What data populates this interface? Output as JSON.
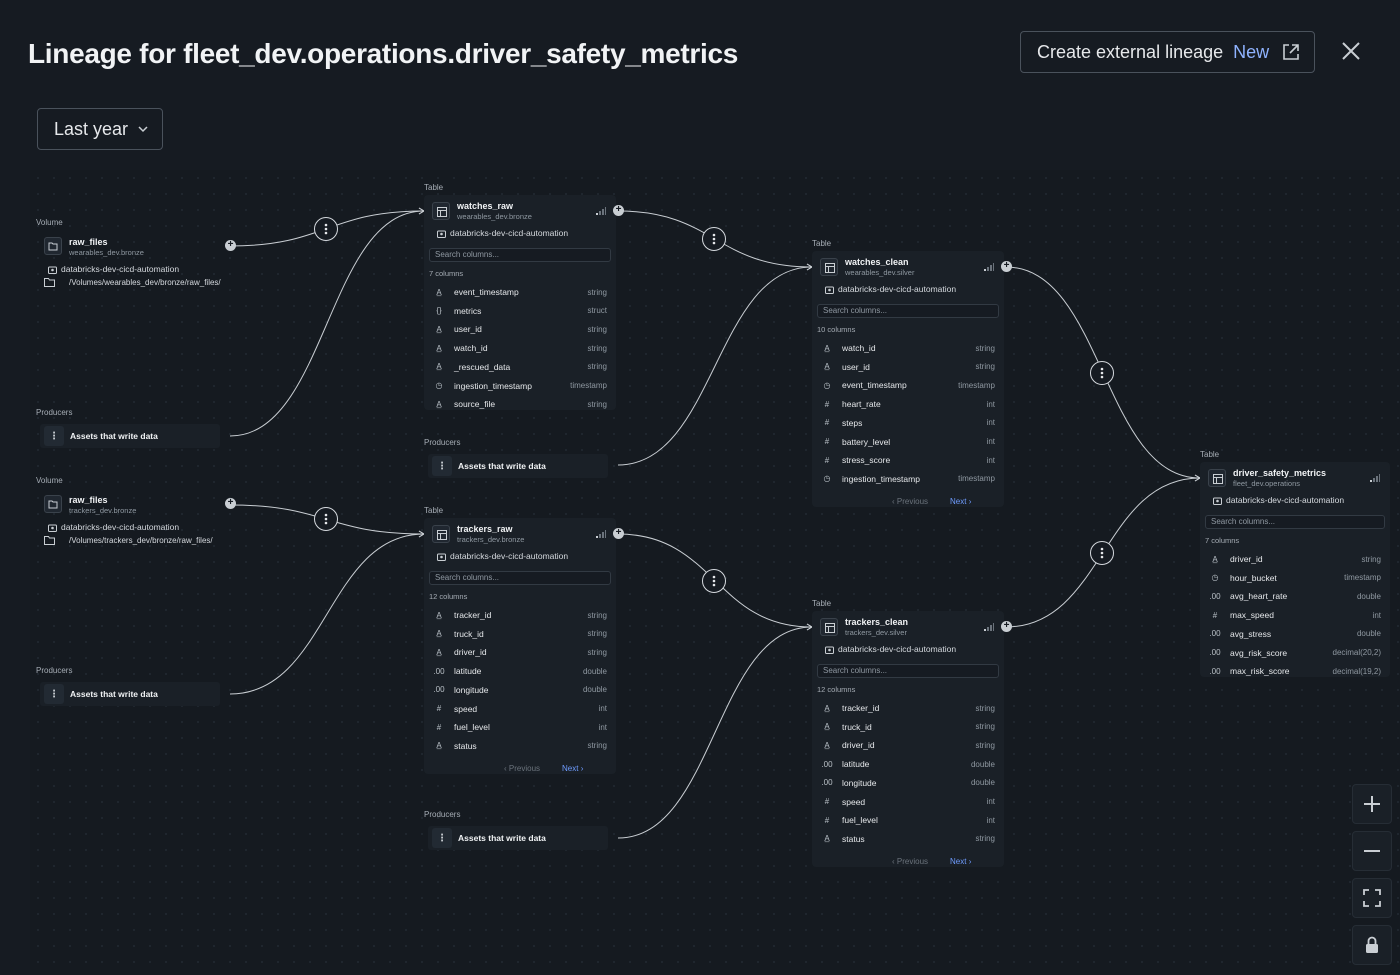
{
  "header": {
    "title": "Lineage for fleet_dev.operations.driver_safety_metrics",
    "external_button_label": "Create external lineage",
    "external_button_badge": "New",
    "time_range_label": "Last year"
  },
  "labels": {
    "table": "Table",
    "volume": "Volume",
    "producers": "Producers",
    "assets_write": "Assets that write data",
    "search_placeholder": "Search columns...",
    "previous": "Previous",
    "next": "Next"
  },
  "volumes": [
    {
      "name": "raw_files",
      "schema": "wearables_dev.bronze",
      "owner": "databricks-dev-cicd-automation",
      "path": "/Volumes/wearables_dev/bronze/raw_files/"
    },
    {
      "name": "raw_files",
      "schema": "trackers_dev.bronze",
      "owner": "databricks-dev-cicd-automation",
      "path": "/Volumes/trackers_dev/bronze/raw_files/"
    }
  ],
  "tables": {
    "watches_raw": {
      "name": "watches_raw",
      "schema": "wearables_dev.bronze",
      "owner": "databricks-dev-cicd-automation",
      "count": "7 columns",
      "columns": [
        {
          "icon": "A",
          "name": "event_timestamp",
          "type": "string"
        },
        {
          "icon": "{}",
          "name": "metrics",
          "type": "struct"
        },
        {
          "icon": "A",
          "name": "user_id",
          "type": "string"
        },
        {
          "icon": "A",
          "name": "watch_id",
          "type": "string"
        },
        {
          "icon": "A",
          "name": "_rescued_data",
          "type": "string"
        },
        {
          "icon": "clock",
          "name": "ingestion_timestamp",
          "type": "timestamp"
        },
        {
          "icon": "A",
          "name": "source_file",
          "type": "string"
        }
      ]
    },
    "trackers_raw": {
      "name": "trackers_raw",
      "schema": "trackers_dev.bronze",
      "owner": "databricks-dev-cicd-automation",
      "count": "12 columns",
      "columns": [
        {
          "icon": "A",
          "name": "tracker_id",
          "type": "string"
        },
        {
          "icon": "A",
          "name": "truck_id",
          "type": "string"
        },
        {
          "icon": "A",
          "name": "driver_id",
          "type": "string"
        },
        {
          "icon": ".00",
          "name": "latitude",
          "type": "double"
        },
        {
          "icon": ".00",
          "name": "longitude",
          "type": "double"
        },
        {
          "icon": "123",
          "name": "speed",
          "type": "int"
        },
        {
          "icon": "123",
          "name": "fuel_level",
          "type": "int"
        },
        {
          "icon": "A",
          "name": "status",
          "type": "string"
        }
      ]
    },
    "watches_clean": {
      "name": "watches_clean",
      "schema": "wearables_dev.silver",
      "owner": "databricks-dev-cicd-automation",
      "count": "10 columns",
      "columns": [
        {
          "icon": "A",
          "name": "watch_id",
          "type": "string"
        },
        {
          "icon": "A",
          "name": "user_id",
          "type": "string"
        },
        {
          "icon": "clock",
          "name": "event_timestamp",
          "type": "timestamp"
        },
        {
          "icon": "123",
          "name": "heart_rate",
          "type": "int"
        },
        {
          "icon": "123",
          "name": "steps",
          "type": "int"
        },
        {
          "icon": "123",
          "name": "battery_level",
          "type": "int"
        },
        {
          "icon": "123",
          "name": "stress_score",
          "type": "int"
        },
        {
          "icon": "clock",
          "name": "ingestion_timestamp",
          "type": "timestamp"
        }
      ]
    },
    "trackers_clean": {
      "name": "trackers_clean",
      "schema": "trackers_dev.silver",
      "owner": "databricks-dev-cicd-automation",
      "count": "12 columns",
      "columns": [
        {
          "icon": "A",
          "name": "tracker_id",
          "type": "string"
        },
        {
          "icon": "A",
          "name": "truck_id",
          "type": "string"
        },
        {
          "icon": "A",
          "name": "driver_id",
          "type": "string"
        },
        {
          "icon": ".00",
          "name": "latitude",
          "type": "double"
        },
        {
          "icon": ".00",
          "name": "longitude",
          "type": "double"
        },
        {
          "icon": "123",
          "name": "speed",
          "type": "int"
        },
        {
          "icon": "123",
          "name": "fuel_level",
          "type": "int"
        },
        {
          "icon": "A",
          "name": "status",
          "type": "string"
        }
      ]
    },
    "driver_safety_metrics": {
      "name": "driver_safety_metrics",
      "schema": "fleet_dev.operations",
      "owner": "databricks-dev-cicd-automation",
      "count": "7 columns",
      "columns": [
        {
          "icon": "A",
          "name": "driver_id",
          "type": "string"
        },
        {
          "icon": "clock",
          "name": "hour_bucket",
          "type": "timestamp"
        },
        {
          "icon": ".00",
          "name": "avg_heart_rate",
          "type": "double"
        },
        {
          "icon": "123",
          "name": "max_speed",
          "type": "int"
        },
        {
          "icon": ".00",
          "name": "avg_stress",
          "type": "double"
        },
        {
          "icon": ".00",
          "name": "avg_risk_score",
          "type": "decimal(20,2)"
        },
        {
          "icon": ".00",
          "name": "max_risk_score",
          "type": "decimal(19,2)"
        }
      ]
    }
  },
  "colors": {
    "background": "#161b22",
    "card": "#1a2027",
    "link": "#6f9cff",
    "edge": "#c9ced3"
  }
}
